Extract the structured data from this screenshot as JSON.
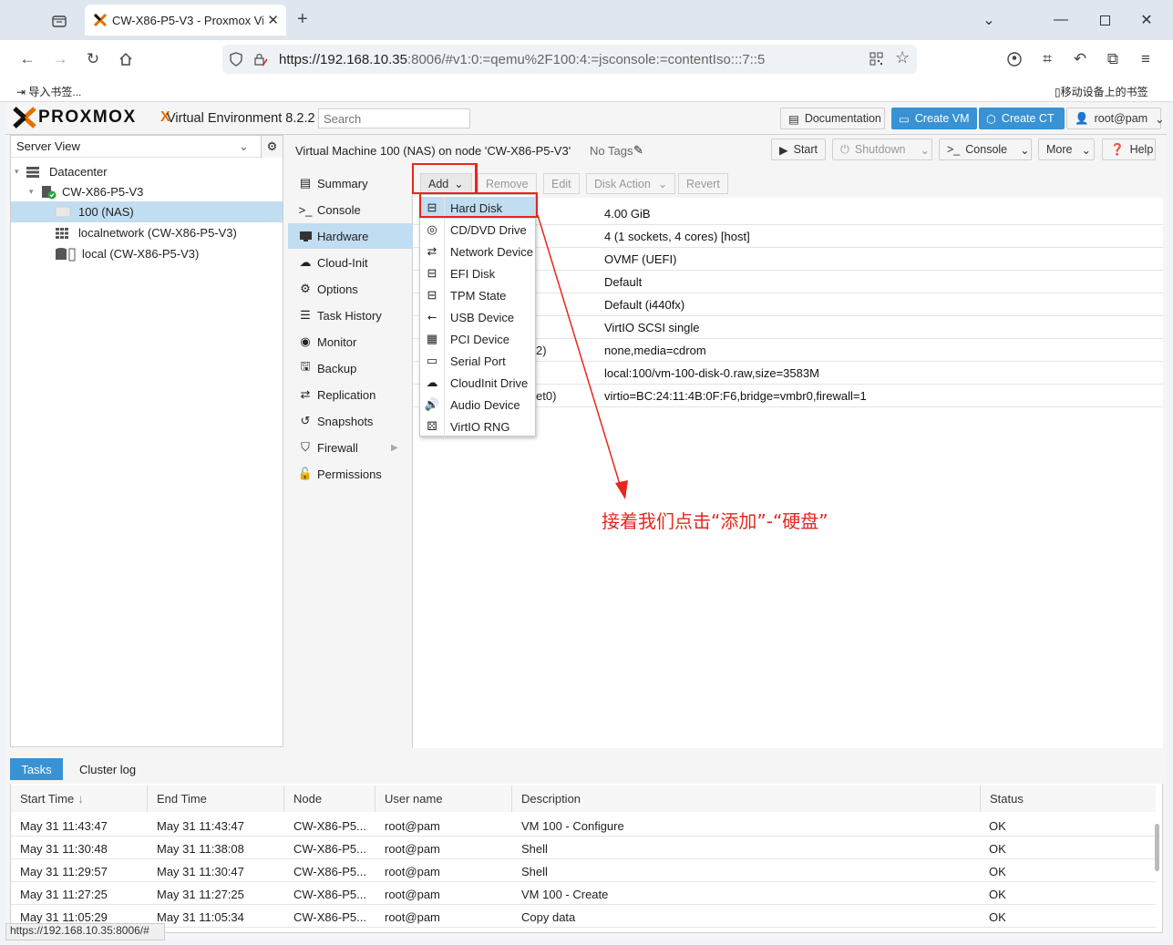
{
  "browser": {
    "tab_title": "CW-X86-P5-V3 - Proxmox Vi",
    "url_host": "https://192.168.10.35",
    "url_rest": ":8006/#v1:0:=qemu%2F100:4:=jsconsole:=contentIso:::7::5",
    "bookmark_import": "导入书签...",
    "bookmark_mobile": "移动设备上的书签",
    "status_url": "https://192.168.10.35:8006/#"
  },
  "pve": {
    "brand_x": "X",
    "brand_text": "PROXMOX",
    "product": "Virtual Environment 8.2.2",
    "search_placeholder": "Search",
    "documentation": "Documentation",
    "create_vm": "Create VM",
    "create_ct": "Create CT",
    "user": "root@pam"
  },
  "tree": {
    "view": "Server View",
    "items": [
      {
        "label": "Datacenter"
      },
      {
        "label": "CW-X86-P5-V3"
      },
      {
        "label": "100 (NAS)"
      },
      {
        "label": "localnetwork (CW-X86-P5-V3)"
      },
      {
        "label": "local (CW-X86-P5-V3)"
      }
    ]
  },
  "main": {
    "title": "Virtual Machine 100 (NAS) on node 'CW-X86-P5-V3'",
    "tags": "No Tags",
    "start": "Start",
    "shutdown": "Shutdown",
    "console": "Console",
    "more": "More",
    "help": "Help"
  },
  "menu": [
    {
      "label": "Summary"
    },
    {
      "label": "Console"
    },
    {
      "label": "Hardware"
    },
    {
      "label": "Cloud-Init"
    },
    {
      "label": "Options"
    },
    {
      "label": "Task History"
    },
    {
      "label": "Monitor"
    },
    {
      "label": "Backup"
    },
    {
      "label": "Replication"
    },
    {
      "label": "Snapshots"
    },
    {
      "label": "Firewall"
    },
    {
      "label": "Permissions"
    }
  ],
  "toolbar": {
    "add": "Add",
    "remove": "Remove",
    "edit": "Edit",
    "disk_action": "Disk Action",
    "revert": "Revert"
  },
  "hardware": [
    {
      "key": "",
      "value": "4.00 GiB"
    },
    {
      "key": "",
      "value": "4 (1 sockets, 4 cores) [host]"
    },
    {
      "key": "",
      "value": "OVMF (UEFI)"
    },
    {
      "key": "",
      "value": "Default"
    },
    {
      "key": "",
      "value": "Default (i440fx)"
    },
    {
      "key": "",
      "value": "VirtIO SCSI single"
    },
    {
      "key": "2)",
      "value": "none,media=cdrom"
    },
    {
      "key": "",
      "value": "local:100/vm-100-disk-0.raw,size=3583M"
    },
    {
      "key": "et0)",
      "value": "virtio=BC:24:11:4B:0F:F6,bridge=vmbr0,firewall=1"
    }
  ],
  "dropdown": [
    {
      "label": "Hard Disk"
    },
    {
      "label": "CD/DVD Drive"
    },
    {
      "label": "Network Device"
    },
    {
      "label": "EFI Disk"
    },
    {
      "label": "TPM State"
    },
    {
      "label": "USB Device"
    },
    {
      "label": "PCI Device"
    },
    {
      "label": "Serial Port"
    },
    {
      "label": "CloudInit Drive"
    },
    {
      "label": "Audio Device"
    },
    {
      "label": "VirtIO RNG"
    }
  ],
  "annotation": "接着我们点击“添加”-“硬盘”",
  "bottom": {
    "tab_tasks": "Tasks",
    "tab_cluster": "Cluster log",
    "columns": [
      "Start Time",
      "End Time",
      "Node",
      "User name",
      "Description",
      "Status"
    ],
    "rows": [
      [
        "May 31 11:43:47",
        "May 31 11:43:47",
        "CW-X86-P5...",
        "root@pam",
        "VM 100 - Configure",
        "OK"
      ],
      [
        "May 31 11:30:48",
        "May 31 11:38:08",
        "CW-X86-P5...",
        "root@pam",
        "Shell",
        "OK"
      ],
      [
        "May 31 11:29:57",
        "May 31 11:30:47",
        "CW-X86-P5...",
        "root@pam",
        "Shell",
        "OK"
      ],
      [
        "May 31 11:27:25",
        "May 31 11:27:25",
        "CW-X86-P5...",
        "root@pam",
        "VM 100 - Create",
        "OK"
      ],
      [
        "May 31 11:05:29",
        "May 31 11:05:34",
        "CW-X86-P5...",
        "root@pam",
        "Copy data",
        "OK"
      ]
    ]
  },
  "colors": {
    "accent": "#3892d4",
    "highlight": "#e8261c",
    "brand_orange": "#e57000"
  }
}
